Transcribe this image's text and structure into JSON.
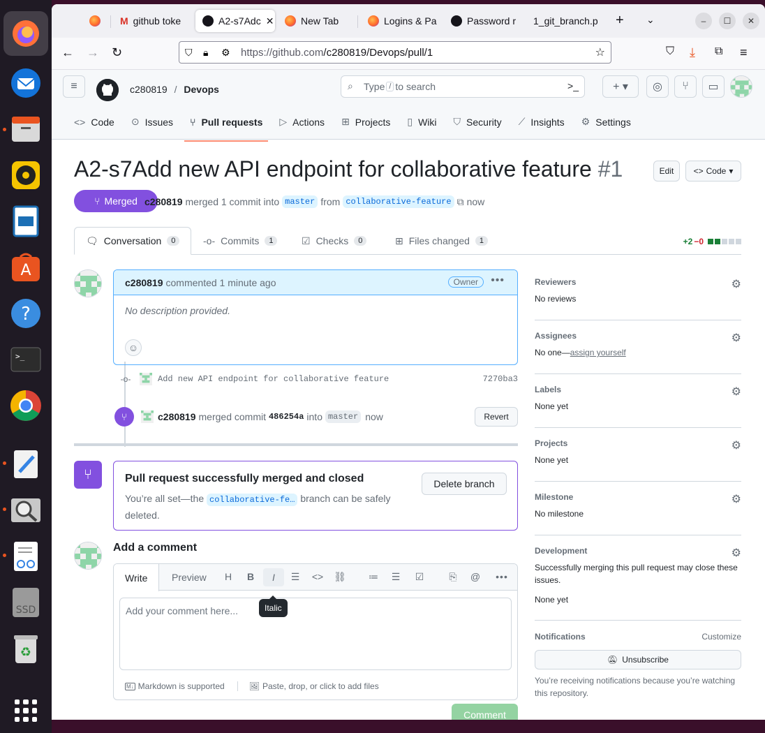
{
  "browser": {
    "tabs": [
      {
        "label": "",
        "icon": "firefox-icon"
      },
      {
        "label": "github toke",
        "icon": "gmail-icon"
      },
      {
        "label": "A2-s7Adc",
        "icon": "github-icon"
      },
      {
        "label": "New Tab",
        "icon": "firefox-icon"
      },
      {
        "label": "Logins & Pa",
        "icon": "firefox-icon"
      },
      {
        "label": "Password r",
        "icon": "github-icon"
      },
      {
        "label": "1_git_branch.p",
        "icon": ""
      }
    ],
    "url_host": "https://github.com",
    "url_path": "/c280819/Devops/pull/1"
  },
  "github": {
    "owner": "c280819",
    "separator": "/",
    "repo": "Devops",
    "search_prefix": "Type",
    "search_key": "/",
    "search_suffix": "to search",
    "nav": [
      {
        "label": "Code",
        "icon": "code-icon"
      },
      {
        "label": "Issues",
        "icon": "issue-icon"
      },
      {
        "label": "Pull requests",
        "icon": "pull-request-icon"
      },
      {
        "label": "Actions",
        "icon": "play-icon"
      },
      {
        "label": "Projects",
        "icon": "table-icon"
      },
      {
        "label": "Wiki",
        "icon": "book-icon"
      },
      {
        "label": "Security",
        "icon": "shield-icon"
      },
      {
        "label": "Insights",
        "icon": "graph-icon"
      },
      {
        "label": "Settings",
        "icon": "gear-icon"
      }
    ]
  },
  "pr": {
    "title": "A2-s7Add new API endpoint for collaborative feature",
    "number": "#1",
    "edit_label": "Edit",
    "code_label": "Code",
    "status": "Merged",
    "author": "c280819",
    "merged_text": "merged 1 commit into",
    "base_branch": "master",
    "from_text": "from",
    "head_branch": "collaborative-feature",
    "time": "now",
    "tabs": [
      {
        "label": "Conversation",
        "count": "0"
      },
      {
        "label": "Commits",
        "count": "1"
      },
      {
        "label": "Checks",
        "count": "0"
      },
      {
        "label": "Files changed",
        "count": "1"
      }
    ],
    "additions": "+2",
    "deletions": "−0"
  },
  "comment": {
    "author": "c280819",
    "action": "commented 1 minute ago",
    "role": "Owner",
    "body": "No description provided."
  },
  "commit": {
    "message": "Add new API endpoint for collaborative feature",
    "sha": "7270ba3"
  },
  "merge_event": {
    "author": "c280819",
    "text1": "merged commit",
    "sha": "486254a",
    "text2": "into",
    "branch": "master",
    "time": "now",
    "revert_label": "Revert"
  },
  "merged_box": {
    "title": "Pull request successfully merged and closed",
    "text1": "You’re all set—the",
    "branch": "collaborative-fe…",
    "text2": "branch can be safely deleted.",
    "delete_label": "Delete branch"
  },
  "add_comment": {
    "title": "Add a comment",
    "write_tab": "Write",
    "preview_tab": "Preview",
    "placeholder": "Add your comment here...",
    "markdown_note": "Markdown is supported",
    "files_note": "Paste, drop, or click to add files",
    "tooltip": "Italic",
    "submit_label": "Comment"
  },
  "sidebar": {
    "reviewers": {
      "title": "Reviewers",
      "value": "No reviews"
    },
    "assignees": {
      "title": "Assignees",
      "value": "No one—",
      "link": "assign yourself"
    },
    "labels": {
      "title": "Labels",
      "value": "None yet"
    },
    "projects": {
      "title": "Projects",
      "value": "None yet"
    },
    "milestone": {
      "title": "Milestone",
      "value": "No milestone"
    },
    "development": {
      "title": "Development",
      "value": "Successfully merging this pull request may close these issues.",
      "value2": "None yet"
    },
    "notifications": {
      "title": "Notifications",
      "customize": "Customize",
      "unsubscribe": "Unsubscribe",
      "note": "You’re receiving notifications because you’re watching this repository."
    }
  },
  "dock": {
    "ssd_label": "SSD"
  },
  "colors": {
    "merged_purple": "#8250df",
    "link_blue": "#0969da",
    "add_green": "#1a7f37",
    "del_red": "#cf222e"
  }
}
